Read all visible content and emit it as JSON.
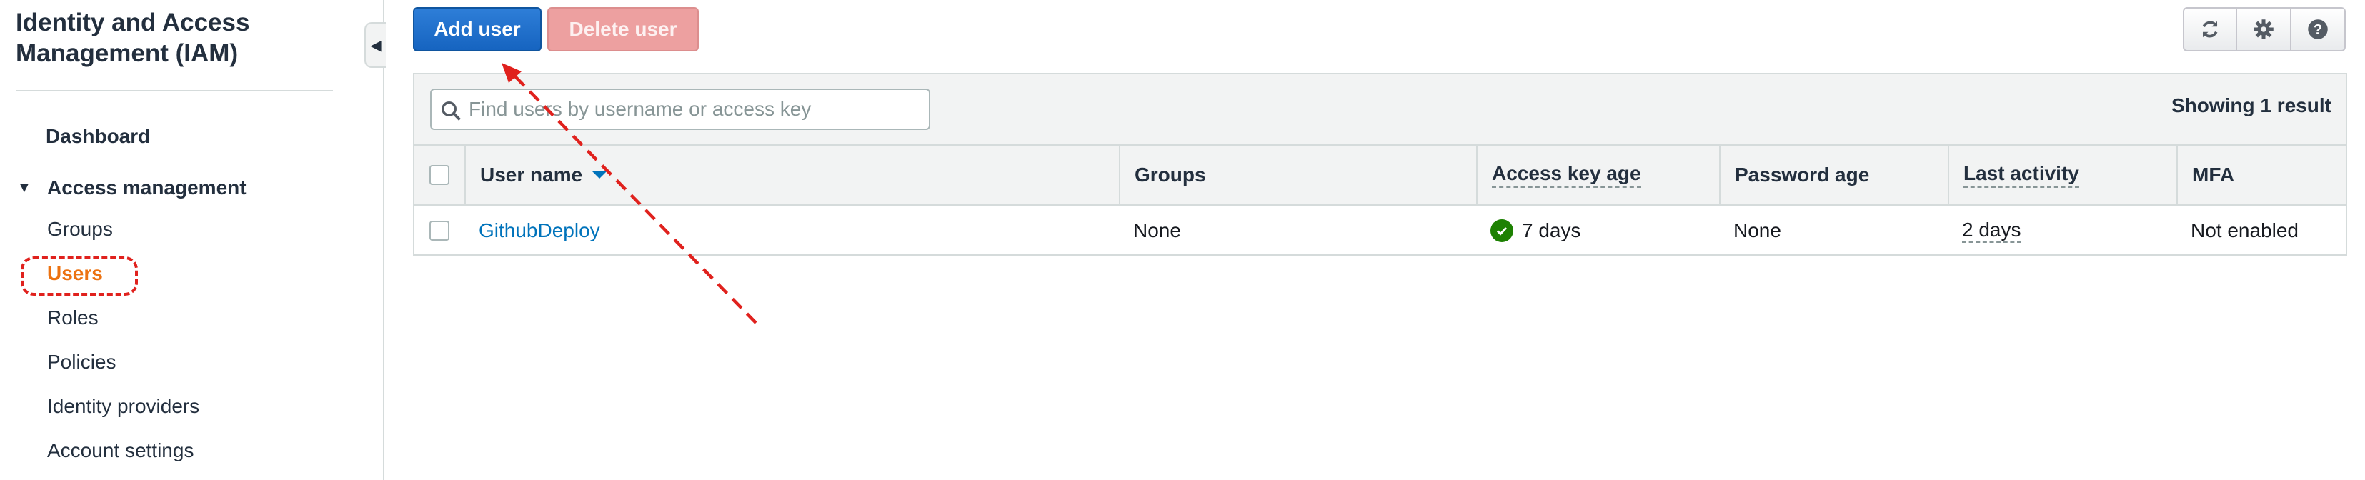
{
  "sidebar": {
    "title": "Identity and Access Management (IAM)",
    "dashboard": "Dashboard",
    "section": "Access management",
    "items": [
      {
        "label": "Groups"
      },
      {
        "label": "Users",
        "active": true
      },
      {
        "label": "Roles"
      },
      {
        "label": "Policies"
      },
      {
        "label": "Identity providers"
      },
      {
        "label": "Account settings"
      }
    ]
  },
  "toolbar": {
    "add_user": "Add user",
    "delete_user": "Delete user",
    "icons": [
      "refresh-icon",
      "gear-icon",
      "help-icon"
    ]
  },
  "filter": {
    "placeholder": "Find users by username or access key",
    "value": "",
    "result_count": "Showing 1 result"
  },
  "table": {
    "columns": [
      "User name",
      "Groups",
      "Access key age",
      "Password age",
      "Last activity",
      "MFA"
    ],
    "rows": [
      {
        "user_name": "GithubDeploy",
        "groups": "None",
        "access_key_age": "7 days",
        "password_age": "None",
        "last_activity": "2 days",
        "mfa": "Not enabled"
      }
    ]
  },
  "colors": {
    "primary": "#1664c0",
    "active_nav": "#ec7211",
    "annotation": "#e0211d",
    "success": "#1d8102",
    "link": "#0073bb"
  }
}
